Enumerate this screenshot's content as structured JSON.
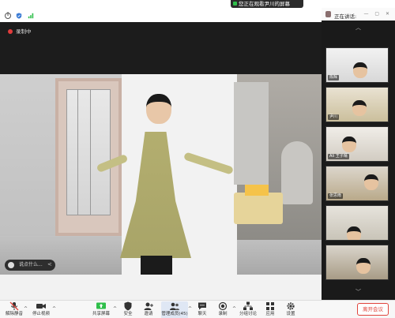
{
  "top": {
    "share_banner": "您正在观看尹川的屏幕",
    "icons": [
      "info-icon",
      "shield-icon",
      "signal-icon"
    ]
  },
  "main": {
    "recording_label": "录制中",
    "chat_placeholder": "说点什么...",
    "chat_expand": "<"
  },
  "panel": {
    "speaking_label": "正在讲话:",
    "header_controls": "— ▢ ✕",
    "scroll_up": "︿",
    "scroll_down": "﹀",
    "tiles": [
      {
        "label": "陈辉"
      },
      {
        "label": "尹川"
      },
      {
        "label": "Ali 王子晴"
      },
      {
        "label": "张思雨"
      },
      {
        "label": ""
      },
      {
        "label": ""
      }
    ]
  },
  "toolbar": {
    "items": [
      {
        "label": "解除静音",
        "icon": "microphone-muted-icon"
      },
      {
        "label": "停止视频",
        "icon": "video-camera-icon"
      },
      {
        "label": "共享屏幕",
        "icon": "share-screen-icon"
      },
      {
        "label": "安全",
        "icon": "shield-icon"
      },
      {
        "label": "邀请",
        "icon": "invite-icon"
      },
      {
        "label": "管理成员(45)",
        "icon": "members-icon"
      },
      {
        "label": "聊天",
        "icon": "chat-icon"
      },
      {
        "label": "录制",
        "icon": "record-icon"
      },
      {
        "label": "分组讨论",
        "icon": "breakout-icon"
      },
      {
        "label": "应用",
        "icon": "apps-icon"
      },
      {
        "label": "设置",
        "icon": "gear-icon"
      }
    ],
    "end_label": "离开会议"
  },
  "colors": {
    "danger": "#e0443c",
    "recording": "#e23c3c",
    "share_green": "#2fbf4a"
  }
}
